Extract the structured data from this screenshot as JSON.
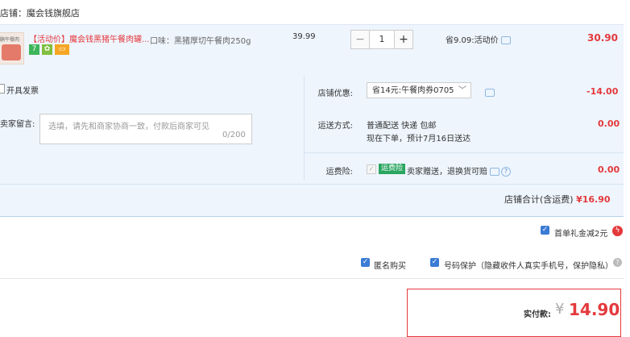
{
  "shop": {
    "label": "店铺：",
    "name": "魔会钱旗舰店"
  },
  "item": {
    "image_label": "腩午餐肉",
    "title": "【活动价】魔会钱黑猪午餐肉罐...",
    "badges": [
      "7",
      "",
      ""
    ],
    "spec": "口味：黑猪厚切午餐肉250g",
    "price": "39.99",
    "quantity": "1",
    "minus": "−",
    "plus": "+",
    "saving": "省9.09:活动价",
    "subtotal": "30.90"
  },
  "invoice": {
    "label": "开具发票"
  },
  "message": {
    "label": "卖家留言:",
    "placeholder": "选填，请先和商家协商一致，付款后商家可见",
    "count": "0/200"
  },
  "discount": {
    "label": "店铺优惠:",
    "selected": "省14元:午餐肉券0705",
    "value": "-14.00"
  },
  "shipping": {
    "label": "运送方式:",
    "method": "普通配送 快递 包邮",
    "eta": "现在下单，预计7月16日送达",
    "value": "0.00"
  },
  "insurance": {
    "label": "运费险:",
    "tag": "运费险",
    "text": "卖家赠送，退换货可赔",
    "value": "0.00"
  },
  "shop_total": {
    "label": "店铺合计(含运费)",
    "value": "¥16.90"
  },
  "gift": {
    "label": "首单礼金减2元"
  },
  "options": {
    "anonymous": "匿名购买",
    "protect": "号码保护（隐藏收件人真实手机号，保护隐私）"
  },
  "pay": {
    "label": "实付款:",
    "currency": "¥",
    "amount": "14.90"
  },
  "colors": {
    "accent": "#e4393c",
    "panel": "#eef5fd",
    "check": "#3a7bd5",
    "insurance_tag": "#2aa660"
  }
}
